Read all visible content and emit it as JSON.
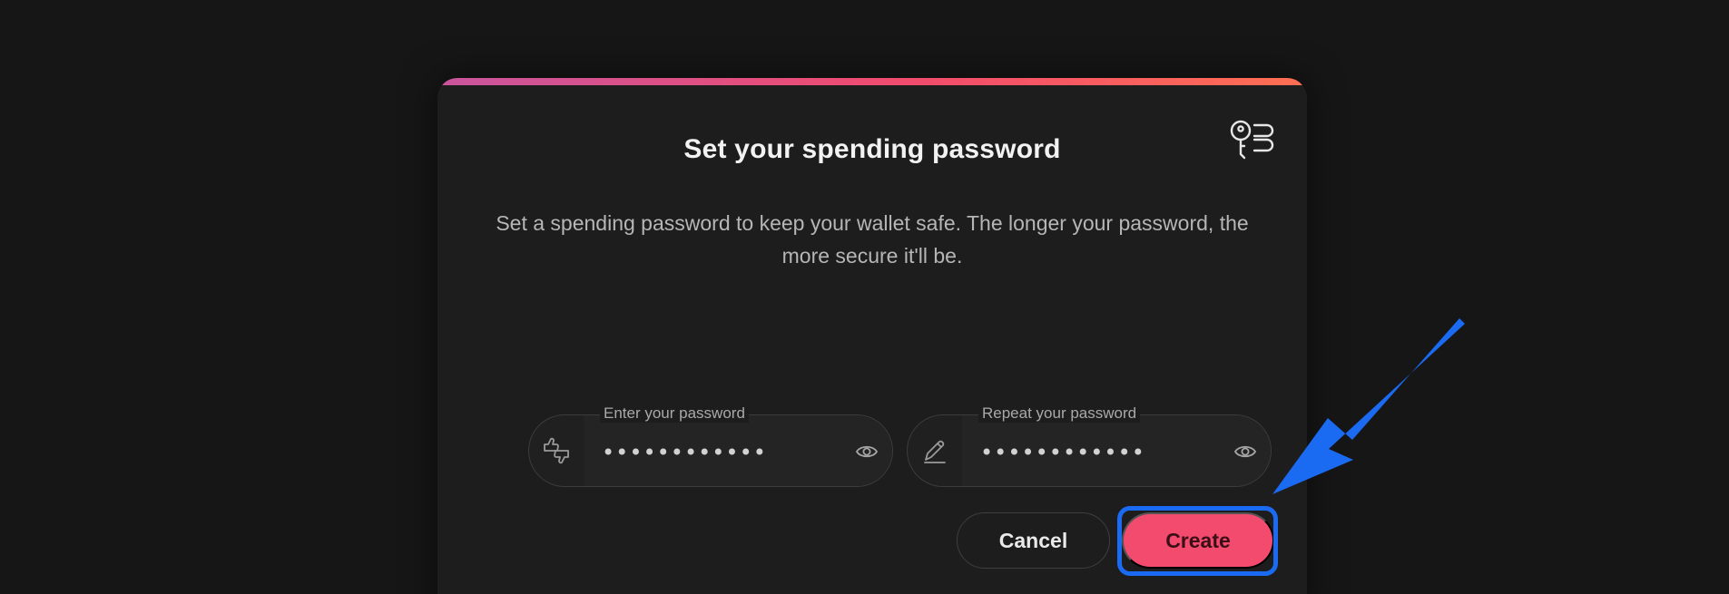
{
  "dialog": {
    "title": "Set your spending password",
    "description": "Set a spending password to keep your wallet safe. The longer your password, the more secure it'll be.",
    "icon": "key-list-icon"
  },
  "fields": {
    "password": {
      "label": "Enter your password",
      "value": "••••••••••••",
      "leading_icon": "thumbs-up-down-icon",
      "trailing_icon": "eye-icon"
    },
    "repeat": {
      "label": "Repeat your password",
      "value": "••••••••••••",
      "leading_icon": "pencil-icon",
      "trailing_icon": "eye-icon"
    }
  },
  "buttons": {
    "cancel": "Cancel",
    "create": "Create"
  },
  "colors": {
    "accent": "#f24b6d",
    "annotation": "#1a6bf2"
  }
}
